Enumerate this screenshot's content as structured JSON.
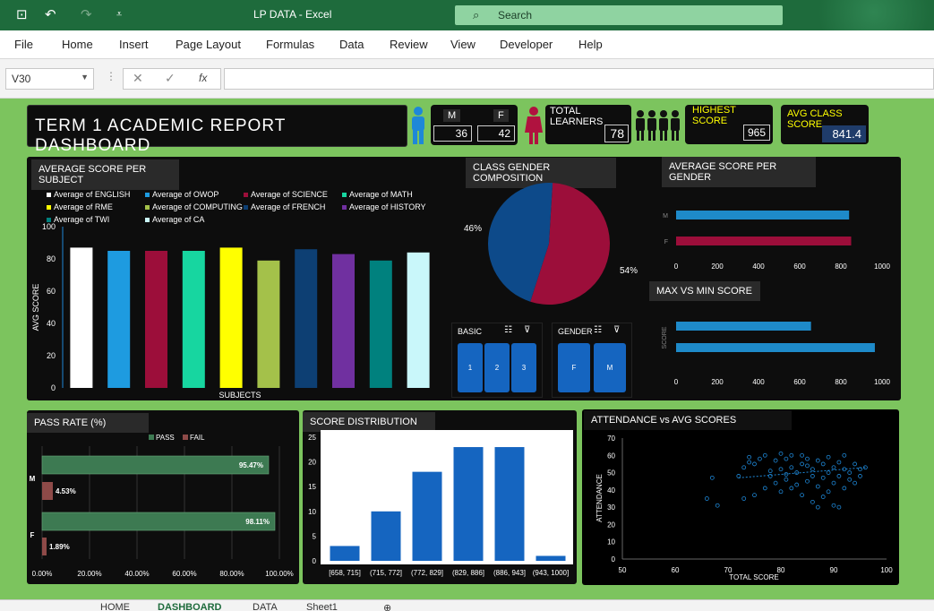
{
  "window": {
    "title": "LP DATA  -  Excel",
    "search_placeholder": "Search"
  },
  "menu": [
    "File",
    "Home",
    "Insert",
    "Page Layout",
    "Formulas",
    "Data",
    "Review",
    "View",
    "Developer",
    "Help"
  ],
  "formula": {
    "cell_ref": "V30",
    "fx": "fx"
  },
  "dashboard": {
    "title": "TERM  1  ACADEMIC  REPORT  DASHBOARD",
    "gender_kpi": {
      "m_label": "M",
      "f_label": "F",
      "m_value": "36",
      "f_value": "42"
    },
    "total_learners": {
      "label": "TOTAL LEARNERS",
      "value": "78"
    },
    "highest_score": {
      "label": "HIGHEST SCORE",
      "value": "965"
    },
    "avg_class_score": {
      "label": "AVG CLASS SCORE",
      "value": "841.4"
    },
    "panels": {
      "avg_subject": "AVERAGE SCORE PER SUBJECT",
      "gender_comp": "CLASS GENDER COMPOSITION",
      "avg_gender": "AVERAGE SCORE PER GENDER",
      "max_min": "MAX VS MIN SCORE",
      "pass_rate": "PASS RATE  (%)",
      "score_dist": "SCORE DISTRIBUTION",
      "attendance": "ATTENDANCE vs AVG SCORES"
    },
    "slicers": {
      "basic": {
        "label": "BASIC",
        "items": [
          "1",
          "2",
          "3"
        ]
      },
      "gender": {
        "label": "GENDER",
        "items": [
          "F",
          "M"
        ]
      }
    }
  },
  "colors": {
    "excel_green": "#1e6b3c",
    "dashboard_bg": "#7cc45e",
    "panel": "#0d0d0d"
  },
  "chart_data": [
    {
      "type": "bar",
      "title": "AVERAGE SCORE PER SUBJECT",
      "xlabel": "SUBJECTS",
      "ylabel": "AVG SCORE",
      "ylim": [
        0,
        100
      ],
      "yticks": [
        "0",
        "20",
        "40",
        "60",
        "80",
        "100"
      ],
      "series": [
        {
          "name": "Average of ENGLISH",
          "value": 87,
          "color": "#ffffff"
        },
        {
          "name": "Average of RME",
          "value": 85,
          "color": "#1e9be0"
        },
        {
          "name": "Average of TWI",
          "value": 85,
          "color": "#9c0e3a"
        },
        {
          "name": "Average of OWOP",
          "value": 85,
          "color": "#17d6a0"
        },
        {
          "name": "Average of COMPUTING",
          "value": 87,
          "color": "#ffff00"
        },
        {
          "name": "Average of CA",
          "value": 79,
          "color": "#a4c14a"
        },
        {
          "name": "Average of SCIENCE",
          "value": 86,
          "color": "#0d3f73"
        },
        {
          "name": "Average of FRENCH",
          "value": 83,
          "color": "#7030a0"
        },
        {
          "name": "Average of MATH",
          "value": 79,
          "color": "#00817e"
        },
        {
          "name": "Average of HISTORY",
          "value": 84,
          "color": "#c9f7fa"
        }
      ],
      "legend": [
        "Average of ENGLISH",
        "Average of OWOP",
        "Average of SCIENCE",
        "Average of MATH",
        "Average of RME",
        "Average of COMPUTING",
        "Average of FRENCH",
        "Average of HISTORY",
        "Average of TWI",
        "Average of CA"
      ],
      "legend_colors": [
        "#ffffff",
        "#1e9be0",
        "#9c0e3a",
        "#17d6a0",
        "#ffff00",
        "#a4c14a",
        "#0d3f73",
        "#7030a0",
        "#00817e",
        "#c9f7fa"
      ]
    },
    {
      "type": "pie",
      "title": "CLASS GENDER COMPOSITION",
      "slices": [
        {
          "label": "54%",
          "value": 54,
          "color": "#9c0e3a"
        },
        {
          "label": "46%",
          "value": 46,
          "color": "#0d4a8a"
        }
      ]
    },
    {
      "type": "bar",
      "title": "AVERAGE SCORE PER GENDER",
      "orientation": "horizontal",
      "categories": [
        "M",
        "F"
      ],
      "values": [
        840,
        850
      ],
      "colors": [
        "#1e8ac9",
        "#9c0e3a"
      ],
      "xlim": [
        0,
        1000
      ],
      "xticks": [
        "0",
        "200",
        "400",
        "600",
        "800",
        "1000"
      ]
    },
    {
      "type": "bar",
      "title": "MAX VS MIN SCORE",
      "orientation": "horizontal",
      "ylabel": "SCORE",
      "values": [
        655,
        965
      ],
      "xlim": [
        0,
        1000
      ],
      "xticks": [
        "0",
        "200",
        "400",
        "600",
        "800",
        "1000"
      ]
    },
    {
      "type": "bar",
      "title": "PASS RATE  (%)",
      "orientation": "horizontal",
      "categories": [
        "M",
        "F"
      ],
      "series": [
        {
          "name": "PASS",
          "values": [
            95.47,
            98.11
          ],
          "labels": [
            "95.47%",
            "98.11%"
          ],
          "color": "#3d7a52"
        },
        {
          "name": "FAIL",
          "values": [
            4.53,
            1.89
          ],
          "labels": [
            "4.53%",
            "1.89%"
          ],
          "color": "#8e4a48"
        }
      ],
      "xlim": [
        0,
        100
      ],
      "xticks": [
        "0.00%",
        "20.00%",
        "40.00%",
        "60.00%",
        "80.00%",
        "100.00%"
      ]
    },
    {
      "type": "bar",
      "title": "SCORE DISTRIBUTION",
      "categories": [
        "[658, 715]",
        "(715, 772]",
        "(772, 829]",
        "(829, 886]",
        "(886, 943]",
        "(943, 1000]"
      ],
      "values": [
        3,
        10,
        18,
        23,
        23,
        1
      ],
      "ylim": [
        0,
        25
      ],
      "yticks": [
        "0",
        "5",
        "10",
        "15",
        "20",
        "25"
      ]
    },
    {
      "type": "scatter",
      "title": "ATTENDANCE vs AVG SCORES",
      "xlabel": "TOTAL SCORE",
      "ylabel": "ATTENDANCE",
      "xlim": [
        50,
        100
      ],
      "ylim": [
        0,
        70
      ],
      "xticks": [
        "50",
        "60",
        "70",
        "80",
        "90",
        "100"
      ],
      "yticks": [
        "0",
        "10",
        "20",
        "30",
        "40",
        "50",
        "60",
        "70"
      ],
      "trendline": [
        [
          72,
          47
        ],
        [
          96,
          53
        ]
      ],
      "points": [
        [
          66,
          35
        ],
        [
          67,
          47
        ],
        [
          68,
          31
        ],
        [
          72,
          48
        ],
        [
          73,
          35
        ],
        [
          73,
          53
        ],
        [
          74,
          56
        ],
        [
          74,
          59
        ],
        [
          75,
          37
        ],
        [
          75,
          55
        ],
        [
          76,
          58
        ],
        [
          77,
          41
        ],
        [
          77,
          60
        ],
        [
          78,
          48
        ],
        [
          78,
          51
        ],
        [
          79,
          44
        ],
        [
          79,
          57
        ],
        [
          80,
          39
        ],
        [
          80,
          52
        ],
        [
          81,
          46
        ],
        [
          81,
          49
        ],
        [
          81,
          58
        ],
        [
          82,
          41
        ],
        [
          82,
          53
        ],
        [
          82,
          60
        ],
        [
          83,
          43
        ],
        [
          83,
          50
        ],
        [
          84,
          37
        ],
        [
          84,
          55
        ],
        [
          85,
          45
        ],
        [
          85,
          58
        ],
        [
          86,
          33
        ],
        [
          86,
          48
        ],
        [
          86,
          52
        ],
        [
          87,
          42
        ],
        [
          87,
          57
        ],
        [
          88,
          36
        ],
        [
          88,
          47
        ],
        [
          88,
          55
        ],
        [
          89,
          39
        ],
        [
          89,
          50
        ],
        [
          89,
          59
        ],
        [
          90,
          44
        ],
        [
          90,
          53
        ],
        [
          90,
          31
        ],
        [
          91,
          48
        ],
        [
          91,
          56
        ],
        [
          92,
          41
        ],
        [
          92,
          52
        ],
        [
          92,
          60
        ],
        [
          93,
          46
        ],
        [
          93,
          50
        ],
        [
          94,
          44
        ],
        [
          94,
          55
        ],
        [
          95,
          48
        ],
        [
          95,
          52
        ],
        [
          96,
          53
        ],
        [
          87,
          30
        ],
        [
          91,
          30
        ],
        [
          84,
          60
        ],
        [
          80,
          61
        ],
        [
          85,
          54
        ]
      ]
    }
  ],
  "sheet_tabs": [
    "HOME",
    "DASHBOARD",
    "DATA",
    "Sheet1"
  ]
}
